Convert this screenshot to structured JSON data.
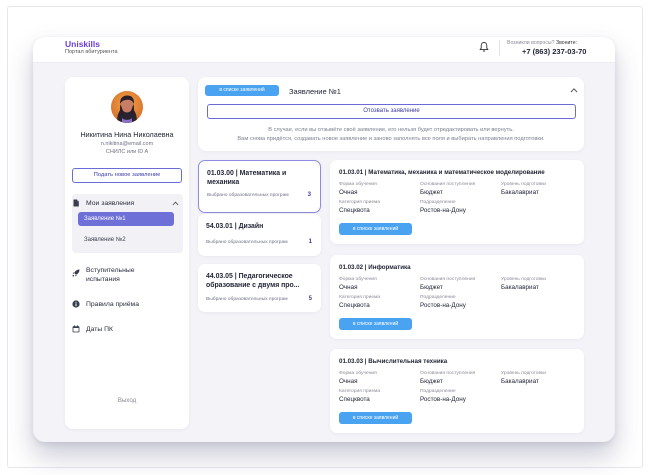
{
  "brand": {
    "name": "Uniskills",
    "subtitle": "Портал абитуриента"
  },
  "header": {
    "question": "Возникли вопросы? ",
    "call_label": "Звоните:",
    "phone": "+7 (863) 237-03-70"
  },
  "user": {
    "name": "Никитина Нина Николаевна",
    "email": "n.nikitina@email.com",
    "snils": "СНИЛС или ID A"
  },
  "sidebar": {
    "new_application": "Подать новое заявление",
    "my_applications": "Мои заявления",
    "applications": [
      "Заявление №1",
      "Заявление №2"
    ],
    "entrance_line1": "Вступительные",
    "entrance_line2": "испытания",
    "rules": "Правила приёма",
    "dates": "Даты ПК",
    "exit": "Выход"
  },
  "application": {
    "status": "в списке заявлений",
    "title": "Заявление №1",
    "withdraw": "Отозвать заявление",
    "warning_line1": "В случае, если вы отзывёте своё заявление, его нельзя будет отредактировать или вернуть.",
    "warning_line2": "Вам снова придётся, создавать новое заявление и заново заполнять все поля и выбирать направления подготовки."
  },
  "directions": [
    {
      "title": "01.03.00 | Математика и механика",
      "programs_label": "Выбрано образовательных програм",
      "count": "3"
    },
    {
      "title": "54.03.01 | Дизайн",
      "programs_label": "Выбрано образовательных програм",
      "count": "1"
    },
    {
      "title": "44.03.05 | Педагогическое образование с двумя про...",
      "programs_label": "Выбрано образовательных програм",
      "count": "5"
    }
  ],
  "field_labels": {
    "form": "Форма обучения",
    "basis": "Основания поступления",
    "level": "Уровень подготовки",
    "category": "Категория приема",
    "division": "Подразделение"
  },
  "programs": [
    {
      "title": "01.03.01 | Математика, механика и математическое моделирование",
      "form": "Очная",
      "basis": "Бюджет",
      "level": "Бакалавриат",
      "category": "Спецквота",
      "division": "Ростов-на-Дону",
      "status": "в списке заявлений"
    },
    {
      "title": "01.03.02 | Информатика",
      "form": "Очная",
      "basis": "Бюджет",
      "level": "Бакалавриат",
      "category": "Спецквота",
      "division": "Ростов-на-Дону",
      "status": "в списке заявлений"
    },
    {
      "title": "01.03.03 | Вычислительная техника",
      "form": "Очная",
      "basis": "Бюджет",
      "level": "Бакалавриат",
      "category": "Спецквота",
      "division": "Ростов-на-Дону",
      "status": "в списке заявлений"
    }
  ],
  "colors": {
    "brand": "#6a3fd6",
    "accent": "#6f6fd8",
    "pill": "#4aa3f0"
  }
}
